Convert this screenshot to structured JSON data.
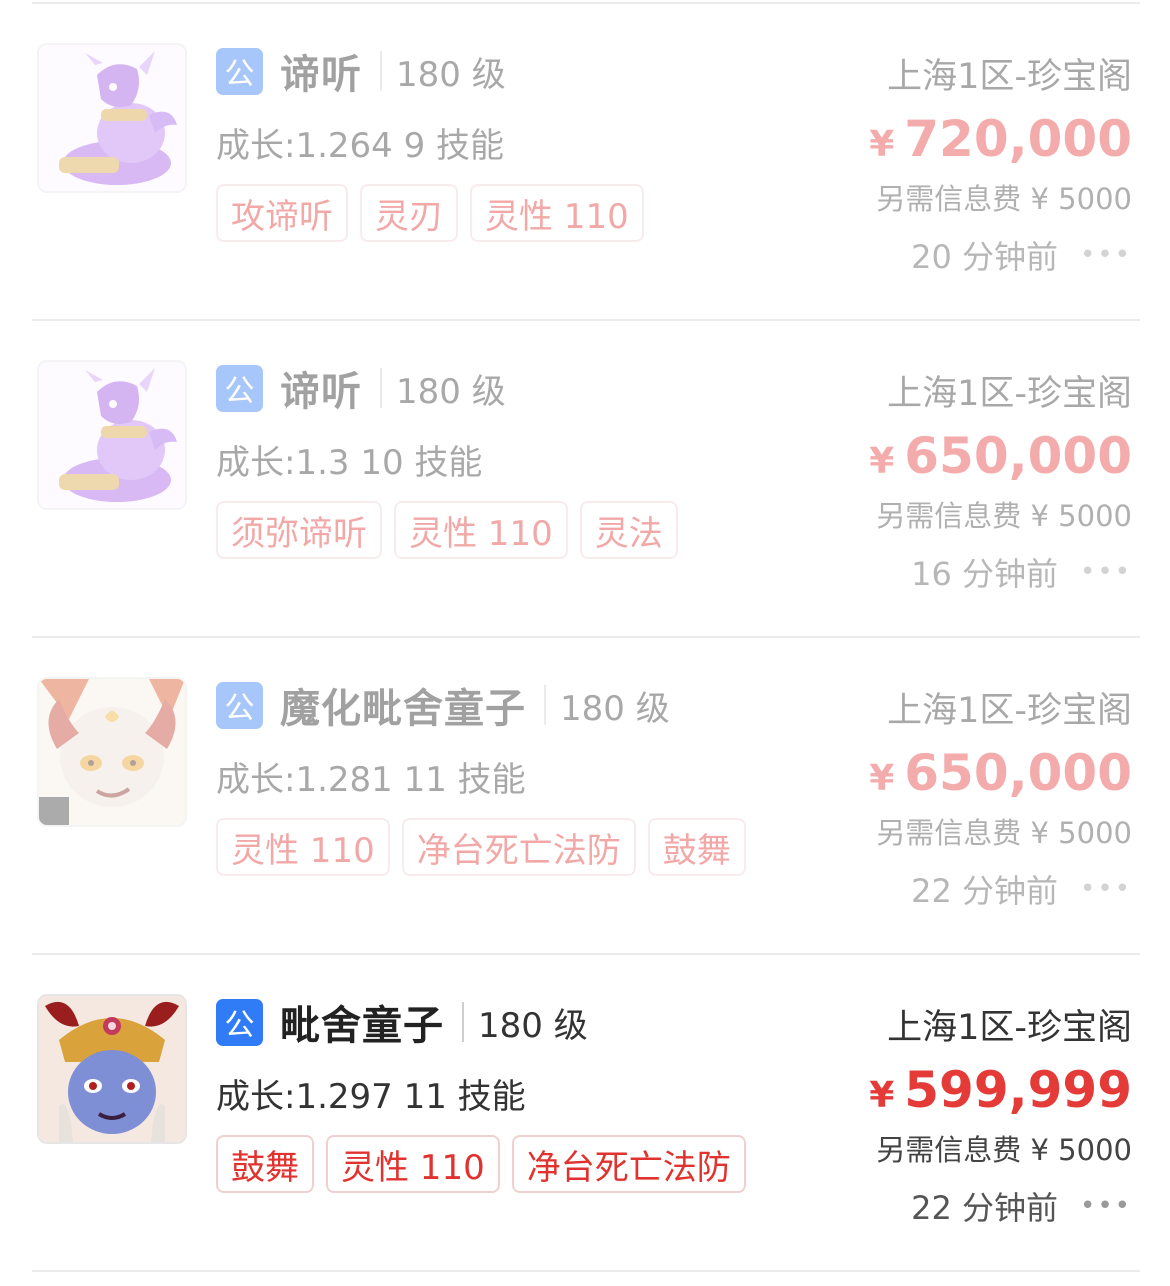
{
  "colors": {
    "accent_red": "#e43b39",
    "badge_blue": "#2f7cf6",
    "tag_border": "#f0d0d0"
  },
  "listings": [
    {
      "badge": "公",
      "name": "谛听",
      "level": "180 级",
      "growth": "成长:1.264 9 技能",
      "tags": [
        "攻谛听",
        "灵刃",
        "灵性 110"
      ],
      "server": "上海1区-珍宝阁",
      "currency": "¥",
      "price": "720,000",
      "fee": "另需信息费 ¥ 5000",
      "time": "20 分钟前",
      "more_icon": "ellipsis-icon",
      "dimmed": true,
      "avatar": "purple-beast"
    },
    {
      "badge": "公",
      "name": "谛听",
      "level": "180 级",
      "growth": "成长:1.3 10 技能",
      "tags": [
        "须弥谛听",
        "灵性 110",
        "灵法"
      ],
      "server": "上海1区-珍宝阁",
      "currency": "¥",
      "price": "650,000",
      "fee": "另需信息费 ¥ 5000",
      "time": "16 分钟前",
      "more_icon": "ellipsis-icon",
      "dimmed": true,
      "avatar": "purple-beast"
    },
    {
      "badge": "公",
      "name": "魔化毗舍童子",
      "level": "180 级",
      "growth": "成长:1.281 11 技能",
      "tags": [
        "灵性 110",
        "净台死亡法防",
        "鼓舞"
      ],
      "server": "上海1区-珍宝阁",
      "currency": "¥",
      "price": "650,000",
      "fee": "另需信息费 ¥ 5000",
      "time": "22 分钟前",
      "more_icon": "ellipsis-icon",
      "dimmed": true,
      "avatar": "demon-child-white"
    },
    {
      "badge": "公",
      "name": "毗舍童子",
      "level": "180 级",
      "growth": "成长:1.297 11 技能",
      "tags": [
        "鼓舞",
        "灵性 110",
        "净台死亡法防"
      ],
      "server": "上海1区-珍宝阁",
      "currency": "¥",
      "price": "599,999",
      "fee": "另需信息费 ¥ 5000",
      "time": "22 分钟前",
      "more_icon": "ellipsis-icon",
      "dimmed": false,
      "avatar": "demon-child-blue"
    }
  ]
}
